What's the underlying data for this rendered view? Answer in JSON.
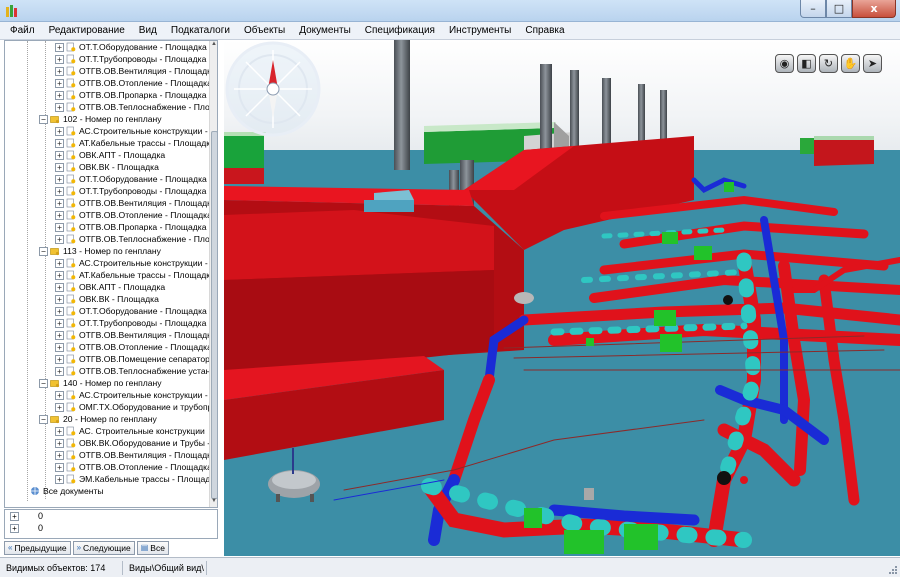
{
  "menu": [
    "Файл",
    "Редактирование",
    "Вид",
    "Подкаталоги",
    "Объекты",
    "Документы",
    "Спецификация",
    "Инструменты",
    "Справка"
  ],
  "window_buttons": {
    "minimize": "–",
    "maximize": "□",
    "close": "x"
  },
  "tree": [
    {
      "level": 2,
      "expander": "+",
      "label": "ОТ.Т.Оборудование - Площадка"
    },
    {
      "level": 2,
      "expander": "+",
      "label": "ОТ.Т.Трубопроводы - Площадка"
    },
    {
      "level": 2,
      "expander": "+",
      "label": "ОТГВ.ОВ.Вентиляция - Площадка"
    },
    {
      "level": 2,
      "expander": "+",
      "label": "ОТГВ.ОВ.Отопление - Площадка"
    },
    {
      "level": 2,
      "expander": "+",
      "label": "ОТГВ.ОВ.Пропарка - Площадка"
    },
    {
      "level": 2,
      "expander": "+",
      "label": "ОТГВ.ОВ.Теплоснабжение - Площ"
    },
    {
      "level": 1,
      "expander": "−",
      "label": "102 - Номер по генплану"
    },
    {
      "level": 2,
      "expander": "+",
      "label": "АС.Строительные конструкции -"
    },
    {
      "level": 2,
      "expander": "+",
      "label": "АТ.Кабельные трассы - Площадк"
    },
    {
      "level": 2,
      "expander": "+",
      "label": "ОВК.АПТ - Площадка"
    },
    {
      "level": 2,
      "expander": "+",
      "label": "ОВК.ВК - Площадка"
    },
    {
      "level": 2,
      "expander": "+",
      "label": "ОТ.Т.Оборудование - Площадка"
    },
    {
      "level": 2,
      "expander": "+",
      "label": "ОТ.Т.Трубопроводы - Площадка"
    },
    {
      "level": 2,
      "expander": "+",
      "label": "ОТГВ.ОВ.Вентиляция - Площадка"
    },
    {
      "level": 2,
      "expander": "+",
      "label": "ОТГВ.ОВ.Отопление - Площадка"
    },
    {
      "level": 2,
      "expander": "+",
      "label": "ОТГВ.ОВ.Пропарка - Площадка"
    },
    {
      "level": 2,
      "expander": "+",
      "label": "ОТГВ.ОВ.Теплоснабжение - Пло"
    },
    {
      "level": 1,
      "expander": "−",
      "label": "113 - Номер по генплану"
    },
    {
      "level": 2,
      "expander": "+",
      "label": "АС.Строительные конструкции -"
    },
    {
      "level": 2,
      "expander": "+",
      "label": "АТ.Кабельные трассы - Площадк"
    },
    {
      "level": 2,
      "expander": "+",
      "label": "ОВК.АПТ - Площадка"
    },
    {
      "level": 2,
      "expander": "+",
      "label": "ОВК.ВК - Площадка"
    },
    {
      "level": 2,
      "expander": "+",
      "label": "ОТ.Т.Оборудование - Площадка"
    },
    {
      "level": 2,
      "expander": "+",
      "label": "ОТ.Т.Трубопроводы - Площадка"
    },
    {
      "level": 2,
      "expander": "+",
      "label": "ОТГВ.ОВ.Вентиляция - Площадк"
    },
    {
      "level": 2,
      "expander": "+",
      "label": "ОТГВ.ОВ.Отопление - Площадка"
    },
    {
      "level": 2,
      "expander": "+",
      "label": "ОТГВ.ОВ.Помещение сепаратор"
    },
    {
      "level": 2,
      "expander": "+",
      "label": "ОТГВ.ОВ.Теплоснабжение устан"
    },
    {
      "level": 1,
      "expander": "−",
      "label": "140 - Номер по генплану"
    },
    {
      "level": 2,
      "expander": "+",
      "label": "АС.Строительные конструкции -"
    },
    {
      "level": 2,
      "expander": "+",
      "label": "ОМГ.ТХ.Оборудование и трубопр"
    },
    {
      "level": 1,
      "expander": "−",
      "label": "20 - Номер по генплану"
    },
    {
      "level": 2,
      "expander": "+",
      "label": "АС. Строительные конструкции"
    },
    {
      "level": 2,
      "expander": "+",
      "label": "ОВК.ВК.Оборудование и Трубы -"
    },
    {
      "level": 2,
      "expander": "+",
      "label": "ОТГВ.ОВ.Вентиляция - Площадк"
    },
    {
      "level": 2,
      "expander": "+",
      "label": "ОТГВ.ОВ.Отопление - Площадка"
    },
    {
      "level": 2,
      "expander": "+",
      "label": "ЭМ.Кабельные трассы - Площадк"
    },
    {
      "level": 0,
      "expander": "",
      "label": "Все документы"
    }
  ],
  "bottom_rows": [
    {
      "expander": "+",
      "value": "0"
    },
    {
      "expander": "+",
      "value": "0"
    }
  ],
  "nav_buttons": [
    "Предыдущие",
    "Следующие",
    "Все"
  ],
  "status": {
    "visible_objects": "Видимых объектов: 174",
    "view_path": "Виды\\Общий вид\\"
  },
  "view_tools": [
    "eye-icon",
    "cube-icon",
    "rotate-icon",
    "hand-icon",
    "pointer-icon"
  ],
  "colors": {
    "pipe_red": "#e0121b",
    "pipe_blue": "#1a2bd6",
    "pipe_cyan": "#2fc7c2",
    "equip_green": "#22c22a",
    "building_red": "#e4101a",
    "viewport_bg": "#3c8ea6"
  }
}
